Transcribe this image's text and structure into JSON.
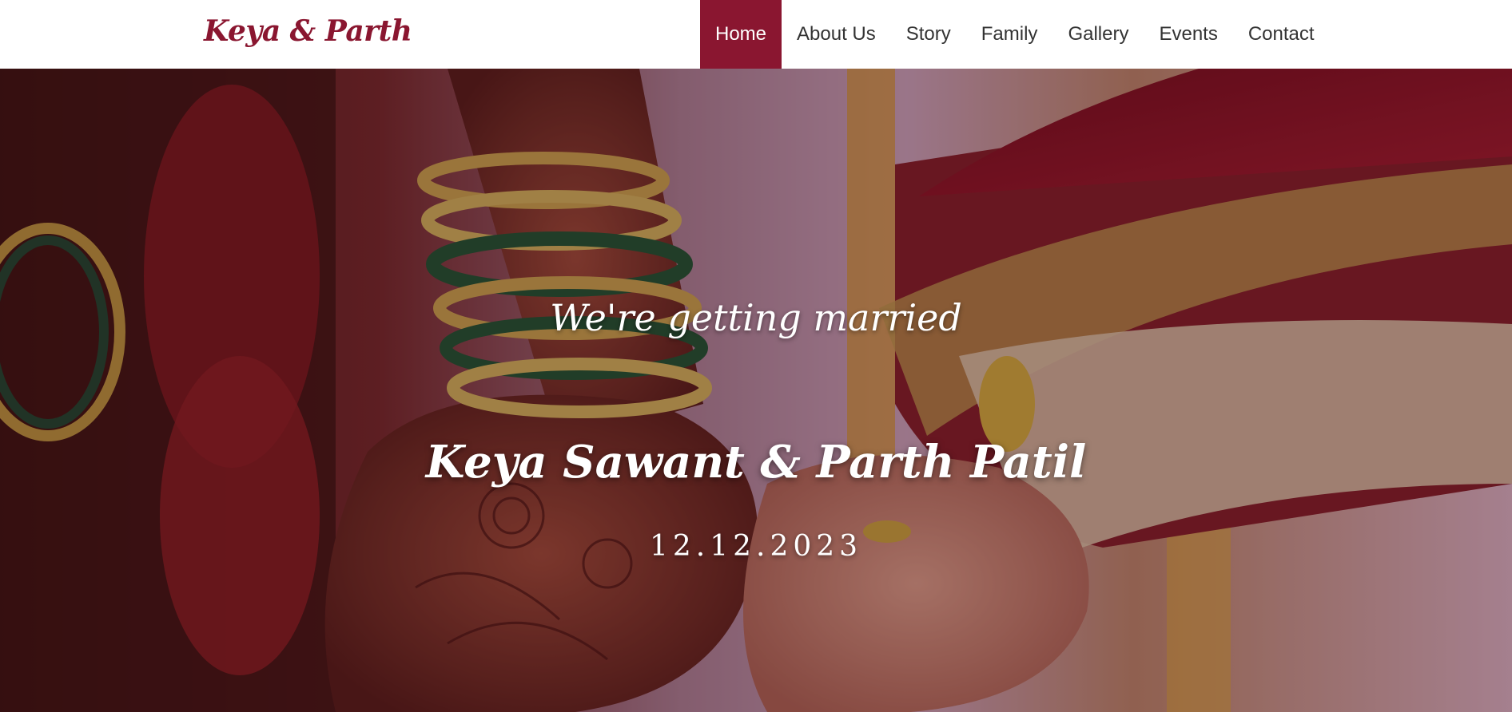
{
  "navbar": {
    "brand": "Keya & Parth",
    "items": [
      {
        "label": "Home",
        "active": true
      },
      {
        "label": "About Us",
        "active": false
      },
      {
        "label": "Story",
        "active": false
      },
      {
        "label": "Family",
        "active": false
      },
      {
        "label": "Gallery",
        "active": false
      },
      {
        "label": "Events",
        "active": false
      },
      {
        "label": "Contact",
        "active": false
      }
    ]
  },
  "hero": {
    "tagline": "We're getting married",
    "couple": "Keya Sawant & Parth Patil",
    "date": "12.12.2023"
  },
  "colors": {
    "accent": "#8a1630",
    "nav_text": "#333333",
    "hero_text": "#ffffff"
  }
}
